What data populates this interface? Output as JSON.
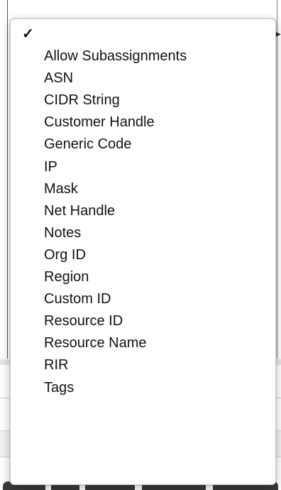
{
  "menu": {
    "checkmark": "✓",
    "items": [
      "",
      "Allow Subassignments",
      "ASN",
      "CIDR String",
      "Customer Handle",
      "Generic Code",
      "IP",
      "Mask",
      "Net Handle",
      "Notes",
      "Org ID",
      "Region",
      "Custom ID",
      "Resource ID",
      "Resource Name",
      "RIR",
      "Tags"
    ],
    "selected_index": 0
  }
}
